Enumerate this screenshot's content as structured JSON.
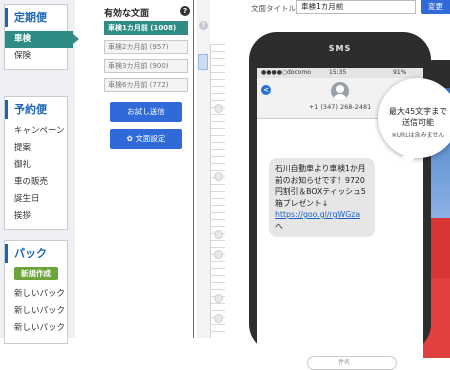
{
  "sidebar": {
    "regular": {
      "title": "定期便",
      "items": [
        "車検",
        "保険"
      ]
    },
    "reservation": {
      "title": "予約便",
      "items": [
        "キャンペーン",
        "提案",
        "御礼",
        "車の販売",
        "誕生日",
        "挨拶"
      ]
    },
    "pack": {
      "title": "パック",
      "new_button": "新規作成",
      "items": [
        "新しいパック",
        "新しいパック",
        "新しいパック"
      ]
    }
  },
  "templates": {
    "title": "有効な文面",
    "help": "?",
    "items": [
      "車検1カ月前 (1008)",
      "車検2カ月前 (957)",
      "車検3カ月前 (900)",
      "車検6カ月前 (772)"
    ],
    "selected_index": 0,
    "test_send": "お試し送信",
    "settings": "文面設定"
  },
  "strip": {
    "help": "?"
  },
  "topbar": {
    "label": "文面タイトル",
    "value": "車検1カ月前",
    "change": "変更"
  },
  "phone": {
    "label": "SMS",
    "carrier": "docomo",
    "time": "15:35",
    "battery": "91%",
    "back": "<",
    "number": "+1 (347) 268-2481",
    "message": "石川自動車より車検1か月前のお知らせです！9720円割引＆BOXティッシュ5箱プレゼント↓",
    "link": "https://goo.gl/rgWGza",
    "suffix": "へ",
    "input_placeholder": "件名"
  },
  "tooltip": {
    "line1": "最大45文字まで",
    "line2": "送信可能",
    "note": "※URLは含みません"
  },
  "colors": {
    "accent_teal": "#2e8c84",
    "button_blue": "#2f6ad8",
    "heading_blue": "#1e66b3",
    "new_green": "#6ca43a"
  }
}
